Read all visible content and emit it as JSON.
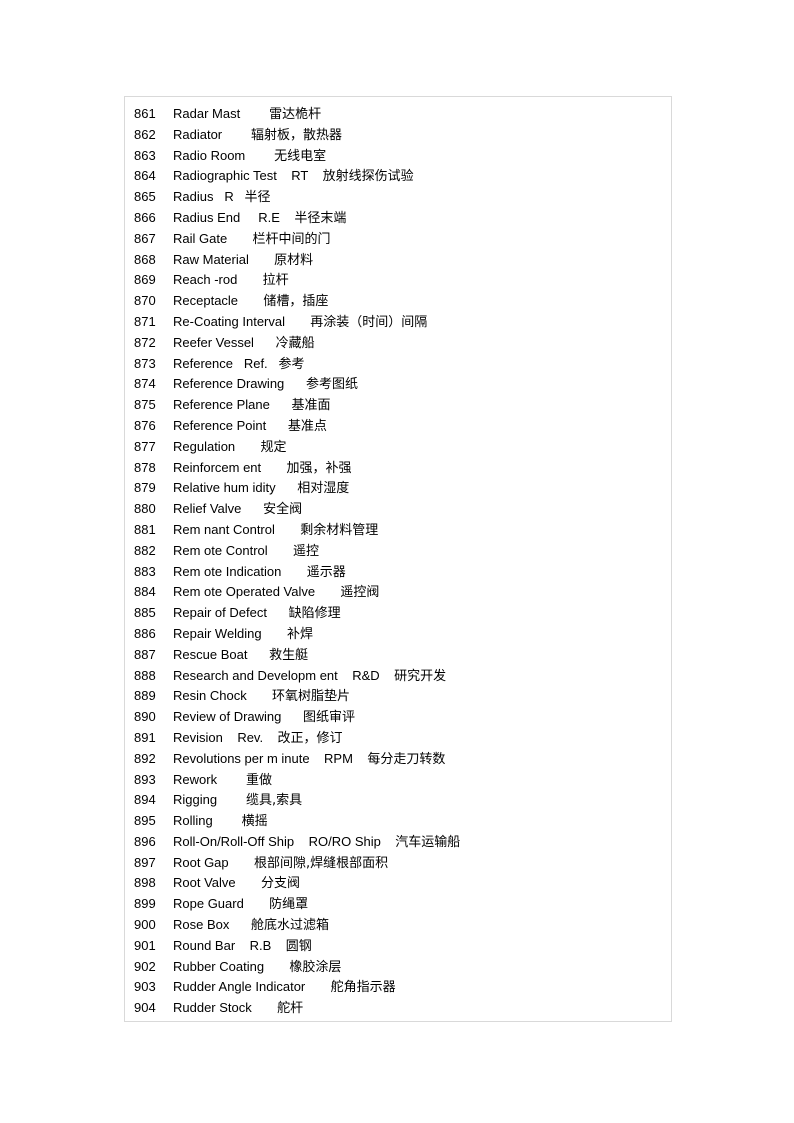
{
  "page": {
    "background_color": "#ffffff",
    "border_color": "#d9d9d9",
    "text_color": "#000000"
  },
  "glossary": {
    "entries": [
      {
        "num": "861",
        "term": "Radar Mast",
        "gap1": "        ",
        "abbr": "",
        "gap2": "",
        "cn": "雷达桅杆"
      },
      {
        "num": "862",
        "term": "Radiator",
        "gap1": "        ",
        "abbr": "",
        "gap2": "",
        "cn": "辐射板，散热器"
      },
      {
        "num": "863",
        "term": "Radio Room",
        "gap1": "        ",
        "abbr": "",
        "gap2": "",
        "cn": "无线电室"
      },
      {
        "num": "864",
        "term": "Radiographic Test",
        "gap1": "    ",
        "abbr": "RT",
        "gap2": "    ",
        "cn": "放射线探伤试验"
      },
      {
        "num": "865",
        "term": "Radius",
        "gap1": "   ",
        "abbr": "R",
        "gap2": "   ",
        "cn": "半径"
      },
      {
        "num": "866",
        "term": "Radius End",
        "gap1": "     ",
        "abbr": "R.E",
        "gap2": "    ",
        "cn": "半径末端"
      },
      {
        "num": "867",
        "term": "Rail Gate",
        "gap1": "       ",
        "abbr": "",
        "gap2": "",
        "cn": "栏杆中间的门"
      },
      {
        "num": "868",
        "term": "Raw Material",
        "gap1": "       ",
        "abbr": "",
        "gap2": "",
        "cn": "原材料"
      },
      {
        "num": "869",
        "term": "Reach -rod",
        "gap1": "       ",
        "abbr": "",
        "gap2": "",
        "cn": "拉杆"
      },
      {
        "num": "870",
        "term": "Receptacle",
        "gap1": "       ",
        "abbr": "",
        "gap2": "",
        "cn": "储槽，插座"
      },
      {
        "num": "871",
        "term": "Re-Coating Interval",
        "gap1": "       ",
        "abbr": "",
        "gap2": "",
        "cn": "再涂装（时间）间隔"
      },
      {
        "num": "872",
        "term": "Reefer Vessel",
        "gap1": "      ",
        "abbr": "",
        "gap2": "",
        "cn": "冷藏船"
      },
      {
        "num": "873",
        "term": "Reference",
        "gap1": "   ",
        "abbr": "Ref.",
        "gap2": "   ",
        "cn": "参考"
      },
      {
        "num": "874",
        "term": "Reference Drawing",
        "gap1": "      ",
        "abbr": "",
        "gap2": "",
        "cn": "参考图纸"
      },
      {
        "num": "875",
        "term": "Reference Plane",
        "gap1": "      ",
        "abbr": "",
        "gap2": "",
        "cn": "基准面"
      },
      {
        "num": "876",
        "term": "Reference Point",
        "gap1": "      ",
        "abbr": "",
        "gap2": "",
        "cn": "基准点"
      },
      {
        "num": "877",
        "term": "Regulation",
        "gap1": "       ",
        "abbr": "",
        "gap2": "",
        "cn": "规定"
      },
      {
        "num": "878",
        "term": "Reinforcem ent",
        "gap1": "       ",
        "abbr": "",
        "gap2": "",
        "cn": "加强，补强"
      },
      {
        "num": "879",
        "term": "Relative hum idity",
        "gap1": "      ",
        "abbr": "",
        "gap2": "",
        "cn": "相对湿度"
      },
      {
        "num": "880",
        "term": "Relief Valve",
        "gap1": "      ",
        "abbr": "",
        "gap2": "",
        "cn": "安全阀"
      },
      {
        "num": "881",
        "term": "Rem nant Control",
        "gap1": "       ",
        "abbr": "",
        "gap2": "",
        "cn": "剩余材料管理"
      },
      {
        "num": "882",
        "term": "Rem ote Control",
        "gap1": "       ",
        "abbr": "",
        "gap2": "",
        "cn": "遥控"
      },
      {
        "num": "883",
        "term": "Rem ote Indication",
        "gap1": "       ",
        "abbr": "",
        "gap2": "",
        "cn": "遥示器"
      },
      {
        "num": "884",
        "term": "Rem ote Operated Valve",
        "gap1": "       ",
        "abbr": "",
        "gap2": "",
        "cn": "遥控阀"
      },
      {
        "num": "885",
        "term": "Repair of Defect",
        "gap1": "      ",
        "abbr": "",
        "gap2": "",
        "cn": "缺陷修理"
      },
      {
        "num": "886",
        "term": "Repair Welding",
        "gap1": "       ",
        "abbr": "",
        "gap2": "",
        "cn": "补焊"
      },
      {
        "num": "887",
        "term": "Rescue Boat",
        "gap1": "      ",
        "abbr": "",
        "gap2": "",
        "cn": "救生艇"
      },
      {
        "num": "888",
        "term": "Research and Developm ent",
        "gap1": "    ",
        "abbr": "R&D",
        "gap2": "    ",
        "cn": "研究开发"
      },
      {
        "num": "889",
        "term": "Resin Chock",
        "gap1": "       ",
        "abbr": "",
        "gap2": "",
        "cn": "环氧树脂垫片"
      },
      {
        "num": "890",
        "term": "Review of Drawing",
        "gap1": "      ",
        "abbr": "",
        "gap2": "",
        "cn": "图纸审评"
      },
      {
        "num": "891",
        "term": "Revision",
        "gap1": "    ",
        "abbr": "Rev.",
        "gap2": "    ",
        "cn": "改正，修订"
      },
      {
        "num": "892",
        "term": "Revolutions per m inute",
        "gap1": "    ",
        "abbr": "RPM",
        "gap2": "    ",
        "cn": "每分走刀转数"
      },
      {
        "num": "893",
        "term": "Rework",
        "gap1": "        ",
        "abbr": "",
        "gap2": "",
        "cn": "重做"
      },
      {
        "num": "894",
        "term": "Rigging",
        "gap1": "        ",
        "abbr": "",
        "gap2": "",
        "cn": "缆具,索具"
      },
      {
        "num": "895",
        "term": "Rolling",
        "gap1": "        ",
        "abbr": "",
        "gap2": "",
        "cn": "横摇"
      },
      {
        "num": "896",
        "term": "Roll-On/Roll-Off Ship",
        "gap1": "    ",
        "abbr": "RO/RO Ship",
        "gap2": "    ",
        "cn": "汽车运输船"
      },
      {
        "num": "897",
        "term": "Root Gap",
        "gap1": "       ",
        "abbr": "",
        "gap2": "",
        "cn": "根部间隙,焊缝根部面积"
      },
      {
        "num": "898",
        "term": "Root Valve",
        "gap1": "       ",
        "abbr": "",
        "gap2": "",
        "cn": "分支阀"
      },
      {
        "num": "899",
        "term": "Rope Guard",
        "gap1": "       ",
        "abbr": "",
        "gap2": "",
        "cn": "防绳罩"
      },
      {
        "num": "900",
        "term": "Rose Box",
        "gap1": "      ",
        "abbr": "",
        "gap2": "",
        "cn": "舱底水过滤箱"
      },
      {
        "num": "901",
        "term": "Round Bar",
        "gap1": "    ",
        "abbr": "R.B",
        "gap2": "    ",
        "cn": "圆钢"
      },
      {
        "num": "902",
        "term": "Rubber Coating",
        "gap1": "       ",
        "abbr": "",
        "gap2": "",
        "cn": "橡胶涂层"
      },
      {
        "num": "903",
        "term": "Rudder Angle Indicator",
        "gap1": "       ",
        "abbr": "",
        "gap2": "",
        "cn": "舵角指示器"
      },
      {
        "num": "904",
        "term": "Rudder Stock",
        "gap1": "       ",
        "abbr": "",
        "gap2": "",
        "cn": "舵杆"
      }
    ]
  }
}
